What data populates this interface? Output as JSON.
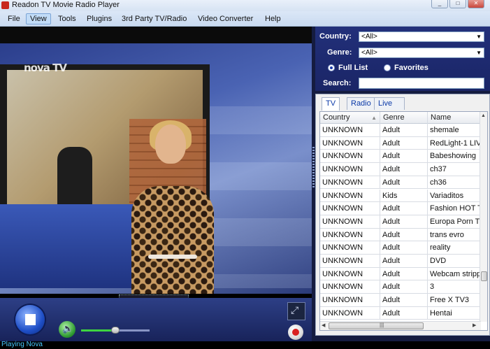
{
  "window": {
    "title": "Readon TV Movie Radio Player",
    "controls": [
      "_",
      "□",
      "✕"
    ]
  },
  "menu": {
    "items": [
      {
        "label": "File"
      },
      {
        "label": "View",
        "active": true
      },
      {
        "label": "Tools"
      },
      {
        "label": "Plugins"
      },
      {
        "label": "3rd Party TV/Radio"
      },
      {
        "label": "Video Converter"
      },
      {
        "label": "Help"
      }
    ]
  },
  "video": {
    "channel_logo": "nova TV"
  },
  "player": {
    "volume": 0.5,
    "stop_icon": "stop-icon",
    "volume_icon": "speaker-icon",
    "fullscreen_icon": "fullscreen-icon",
    "record_icon": "record-icon"
  },
  "filters": {
    "country_label": "Country:",
    "country_value": "<All>",
    "genre_label": "Genre:",
    "genre_value": "<All>",
    "full_list_label": "Full List",
    "favorites_label": "Favorites",
    "selected_list": "Full List",
    "search_label": "Search:",
    "search_value": ""
  },
  "tabs": [
    {
      "label": "TV",
      "selected": true
    },
    {
      "label": "Radio",
      "selected": false
    },
    {
      "label": "Live Sports",
      "selected": false
    }
  ],
  "table": {
    "columns": [
      "Country",
      "Genre",
      "Name"
    ],
    "rows": [
      [
        "UNKNOWN",
        "Adult",
        "shemale"
      ],
      [
        "UNKNOWN",
        "Adult",
        "RedLight-1 LIV"
      ],
      [
        "UNKNOWN",
        "Adult",
        "Babeshowing"
      ],
      [
        "UNKNOWN",
        "Adult",
        "ch37"
      ],
      [
        "UNKNOWN",
        "Adult",
        "ch36"
      ],
      [
        "UNKNOWN",
        "Kids",
        "Variaditos"
      ],
      [
        "UNKNOWN",
        "Adult",
        "Fashion HOT T"
      ],
      [
        "UNKNOWN",
        "Adult",
        "Europa Porn T"
      ],
      [
        "UNKNOWN",
        "Adult",
        "trans evro"
      ],
      [
        "UNKNOWN",
        "Adult",
        "reality"
      ],
      [
        "UNKNOWN",
        "Adult",
        "DVD"
      ],
      [
        "UNKNOWN",
        "Adult",
        "Webcam stripp"
      ],
      [
        "UNKNOWN",
        "Adult",
        "3"
      ],
      [
        "UNKNOWN",
        "Adult",
        "Free X TV3"
      ],
      [
        "UNKNOWN",
        "Adult",
        "Hentai"
      ]
    ]
  },
  "status": {
    "text": "Playing Nova"
  },
  "colors": {
    "panel_blue": "#1f2b72",
    "status_text": "#48c8ff",
    "tab_text": "#0b3aa8"
  }
}
